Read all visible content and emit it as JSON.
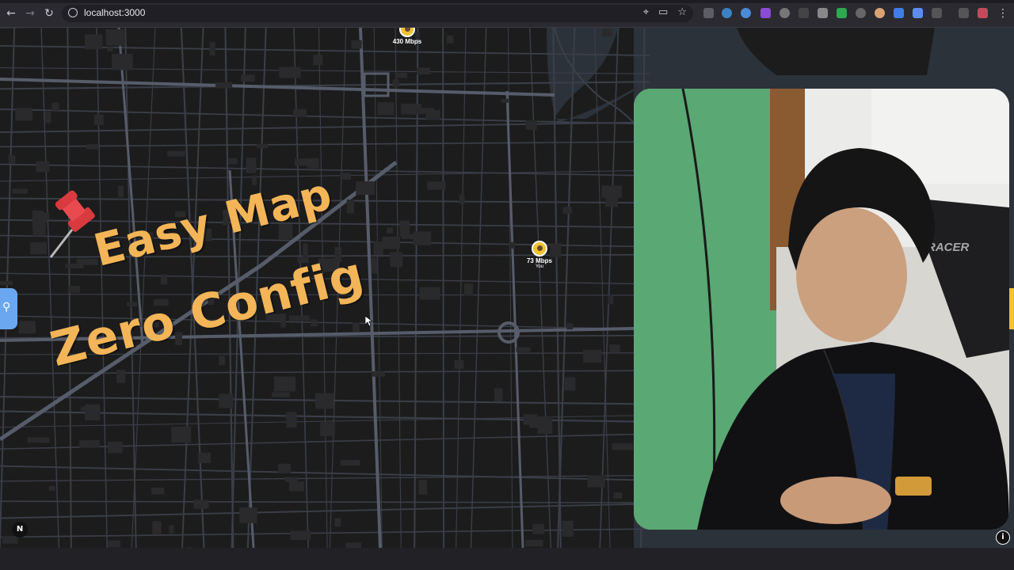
{
  "browser": {
    "url": "localhost:3000",
    "icons": [
      "back-arrow-icon",
      "forward-arrow-icon",
      "reload-icon",
      "site-info-icon",
      "location-icon",
      "cast-icon",
      "bookmark-star-icon",
      "extensions-icon",
      "menu-icon"
    ]
  },
  "headline": {
    "line1": "Easy Map",
    "line2": "Zero Config",
    "color": "#f3b557"
  },
  "markers": [
    {
      "label": "430 Mbps",
      "sub": ""
    },
    {
      "label": "73 Mbps",
      "sub": "You"
    }
  ],
  "map": {
    "north_label": "N",
    "info_label": "i",
    "search_icon": "magnifier-icon"
  },
  "colors": {
    "map_bg": "#1c1c1c",
    "roads": "#4a4f5c",
    "water": "#2c323a",
    "accent": "#f3b557",
    "search_tab": "#6aa7f0"
  }
}
